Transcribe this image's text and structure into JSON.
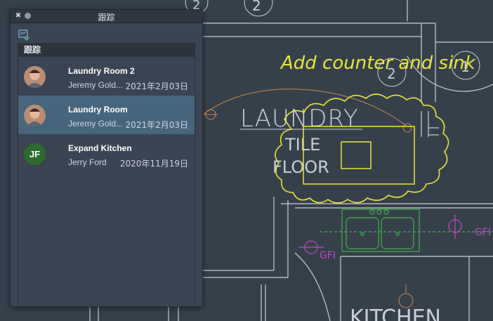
{
  "panel": {
    "title": "跟踪",
    "section_header": "跟踪",
    "items": [
      {
        "title": "Laundry Room 2",
        "author": "Jeremy Gold...",
        "date": "2021年2月03日",
        "avatar_icon": "person-photo-icon",
        "selected": false
      },
      {
        "title": "Laundry Room",
        "author": "Jeremy Gold...",
        "date": "2021年2月03日",
        "avatar_icon": "person-photo-icon",
        "selected": true
      },
      {
        "title": "Expand Kitchen",
        "author": "Jerry Ford",
        "date": "2020年11月19日",
        "avatar_initials": "JF",
        "selected": false
      }
    ]
  },
  "drawing": {
    "labels": {
      "laundry": "LAUNDRY",
      "tile": "TILE",
      "floor": "FLOOR",
      "kitchen": "KITCHEN",
      "markup": "Add counter and sink",
      "gfi": "GFI",
      "circle_a": "2",
      "circle_b": "1",
      "top_a": "2",
      "top_b": "2"
    },
    "colors": {
      "background": "#36404b",
      "walls": "#c9ced6",
      "markup": "#e8e63a",
      "fixtures": "#3fb24a",
      "electrical": "#c04ac4",
      "door": "#c98a52"
    }
  }
}
